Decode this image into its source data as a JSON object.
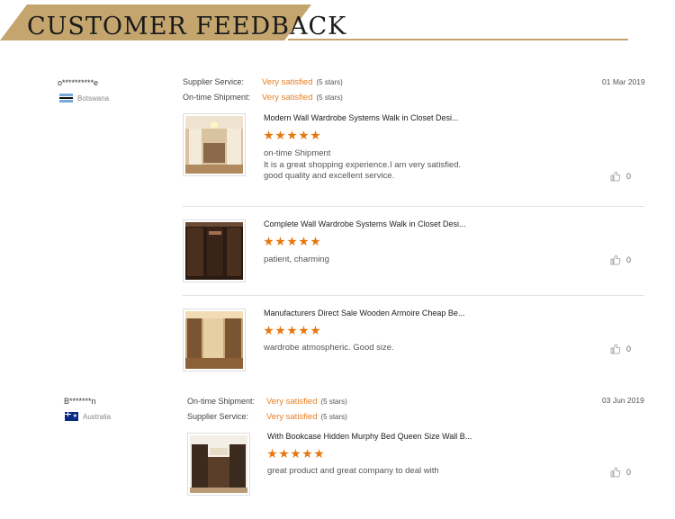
{
  "section_title": "CUSTOMER FEEDBACK",
  "colors": {
    "banner": "#c4a56e",
    "accent": "#e67e22",
    "star": "#e8760f"
  },
  "reviews": [
    {
      "user": "o**********e",
      "country": "Botswana",
      "date": "01 Mar 2019",
      "ratings": [
        {
          "label": "Supplier Service:",
          "value": "Very satisfied",
          "count": "(5 stars)"
        },
        {
          "label": "On-time Shipment:",
          "value": "Very satisfied",
          "count": "(5 stars)"
        }
      ],
      "items": [
        {
          "title": "Modern Wall Wardrobe Systems Walk in Closet Desi...",
          "stars": 5,
          "comment_lines": [
            "on-time Shipment",
            "It is a great shopping experience.I am very satisfied.",
            "good quality and excellent service."
          ],
          "likes": "0"
        },
        {
          "title": "Complete Wall Wardrobe Systems Walk in Closet Desi...",
          "stars": 5,
          "comment_lines": [
            "patient, charming"
          ],
          "likes": "0"
        },
        {
          "title": "Manufacturers Direct Sale Wooden Armoire Cheap Be...",
          "stars": 5,
          "comment_lines": [
            "wardrobe atmospheric. Good size."
          ],
          "likes": "0"
        }
      ]
    },
    {
      "user": "B*******n",
      "country": "Australia",
      "date": "03 Jun 2019",
      "ratings": [
        {
          "label": "On-time Shipment:",
          "value": "Very satisfied",
          "count": "(5 stars)"
        },
        {
          "label": "Supplier Service:",
          "value": "Very satisfied",
          "count": "(5 stars)"
        }
      ],
      "items": [
        {
          "title": "With Bookcase Hidden Murphy Bed Queen Size Wall B...",
          "stars": 5,
          "comment_lines": [
            "great product and great company to deal with"
          ],
          "likes": "0"
        }
      ]
    }
  ]
}
